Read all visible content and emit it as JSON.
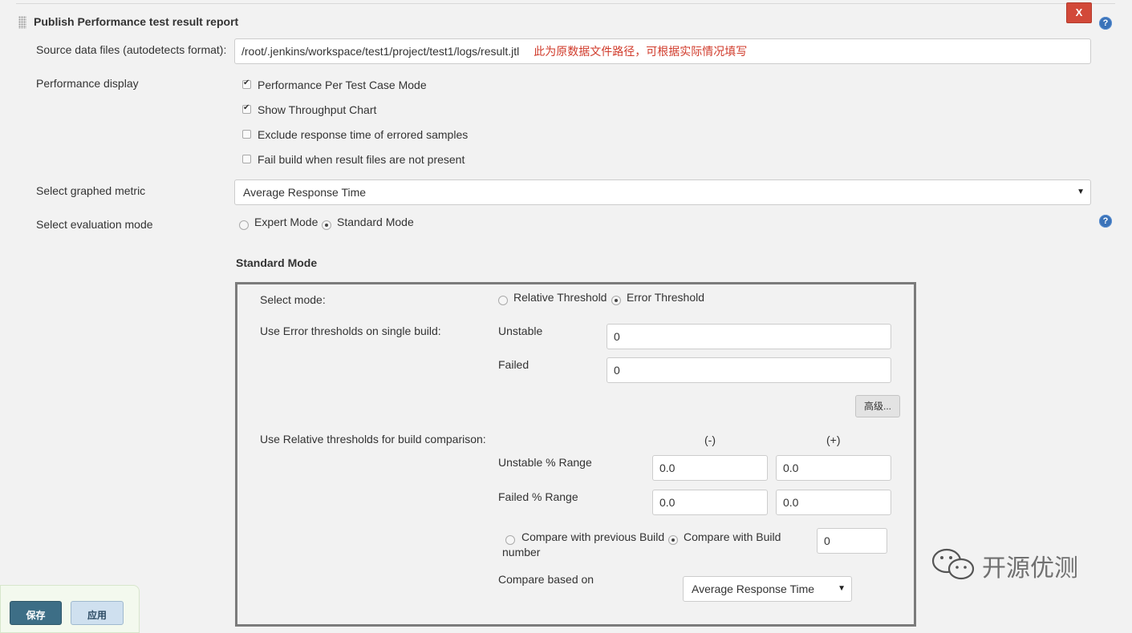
{
  "section": {
    "title": "Publish Performance test result report",
    "close_label": "X",
    "help_glyph": "?"
  },
  "source": {
    "label": "Source data files (autodetects format):",
    "value": "/root/.jenkins/workspace/test1/project/test1/logs/result.jtl",
    "note": "此为原数据文件路径，可根据实际情况填写"
  },
  "display": {
    "label": "Performance display",
    "options": [
      {
        "label": "Performance Per Test Case Mode",
        "checked": true
      },
      {
        "label": "Show Throughput Chart",
        "checked": true
      },
      {
        "label": "Exclude response time of errored samples",
        "checked": false
      },
      {
        "label": "Fail build when result files are not present",
        "checked": false
      }
    ]
  },
  "metric": {
    "label": "Select graphed metric",
    "selected": "Average Response Time"
  },
  "evaluation": {
    "label": "Select evaluation mode",
    "expert": "Expert Mode",
    "standard": "Standard Mode",
    "selected": "Standard Mode"
  },
  "standard_mode": {
    "heading": "Standard Mode",
    "select_mode_label": "Select mode:",
    "relative_threshold": "Relative Threshold",
    "error_threshold": "Error Threshold",
    "selected": "Error Threshold",
    "error_label": "Use Error thresholds on single build:",
    "unstable_label": "Unstable",
    "unstable_value": "0",
    "failed_label": "Failed",
    "failed_value": "0",
    "advanced_button": "高级...",
    "relative_label": "Use Relative thresholds for build comparison:",
    "minus_header": "(-)",
    "plus_header": "(+)",
    "unstable_range_label": "Unstable % Range",
    "unstable_minus": "0.0",
    "unstable_plus": "0.0",
    "failed_range_label": "Failed % Range",
    "failed_minus": "0.0",
    "failed_plus": "0.0",
    "compare_previous": "Compare with previous Build",
    "compare_previous_cont": "number",
    "compare_build": "Compare with Build",
    "compare_build_value": "0",
    "compare_based_label": "Compare based on",
    "compare_based_selected": "Average Response Time"
  },
  "footer": {
    "save": "保存",
    "apply": "应用"
  },
  "watermark": {
    "text": "开源优测"
  }
}
